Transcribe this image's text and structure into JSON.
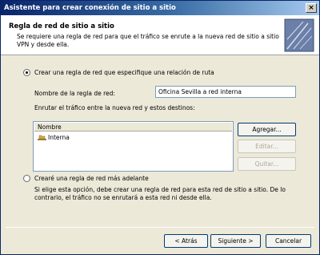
{
  "window": {
    "title": "Asistente para crear conexión de sitio a sitio",
    "close_glyph": "×"
  },
  "header": {
    "title": "Regla de red de sitio a sitio",
    "description": "Se requiere una regla de red para que el tráfico se enrute a la nueva red de sitio a sitio VPN y desde ella."
  },
  "option_create_now": {
    "label": "Crear una regla de red que especifique una relación de ruta",
    "checked": true
  },
  "rule_name": {
    "label": "Nombre de la regla de red:",
    "value": "Oficina Sevilla a red interna"
  },
  "destinations": {
    "label": "Enrutar el tráfico entre la nueva red y estos destinos:",
    "column_header": "Nombre",
    "items": [
      {
        "name": "Interna",
        "icon": "network-icon"
      }
    ]
  },
  "list_buttons": {
    "add": "Agregar...",
    "edit": "Editar...",
    "remove": "Quitar..."
  },
  "option_create_later": {
    "label": "Crearé una regla de red más adelante",
    "checked": false,
    "note": "Si elige esta opción, debe crear una regla de red para esta red de sitio a sitio. De lo contrario, el tráfico no se enrutará a esta red ni desde ella."
  },
  "footer": {
    "back": "< Atrás",
    "next": "Siguiente >",
    "cancel": "Cancelar"
  }
}
